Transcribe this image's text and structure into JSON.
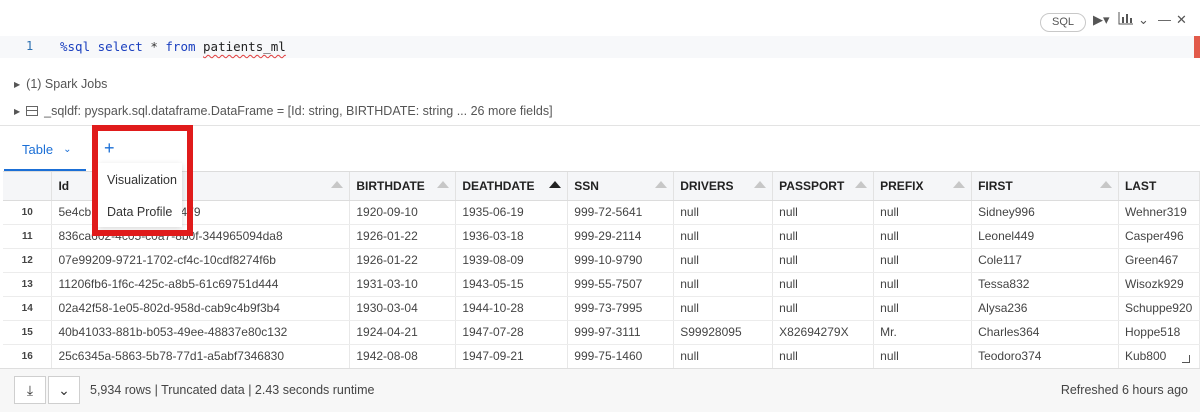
{
  "toolbar": {
    "language": "SQL",
    "run_icon": "play-icon",
    "chart_icon": "chart-icon",
    "collapse_icon": "chevron-down-icon",
    "minimize_icon": "minus-icon",
    "close_icon": "close-icon"
  },
  "editor": {
    "line_number": "1",
    "magic": "%sql",
    "keyword_select": "select",
    "star": "*",
    "keyword_from": "from",
    "table_name": "patients_ml"
  },
  "info": {
    "spark_jobs": "(1) Spark Jobs",
    "dataframe": "_sqldf:  pyspark.sql.dataframe.DataFrame = [Id: string, BIRTHDATE: string ... 26 more fields]"
  },
  "tabs": {
    "table_label": "Table",
    "add_label": "+"
  },
  "dropdown": {
    "visualization": "Visualization",
    "data_profile": "Data Profile"
  },
  "table": {
    "columns": [
      "Id",
      "BIRTHDATE",
      "DEATHDATE",
      "SSN",
      "DRIVERS",
      "PASSPORT",
      "PREFIX",
      "FIRST",
      "LAST"
    ],
    "sorted_column": "DEATHDATE",
    "rows": [
      {
        "n": "10",
        "cells": [
          "5e4cb... 38-5cbc5b988479",
          "1920-09-10",
          "1935-06-19",
          "999-72-5641",
          "null",
          "null",
          "null",
          "Sidney996",
          "Wehner319"
        ]
      },
      {
        "n": "11",
        "cells": [
          "836ca602-4c05-c0a7-8b0f-344965094da8",
          "1926-01-22",
          "1936-03-18",
          "999-29-2114",
          "null",
          "null",
          "null",
          "Leonel449",
          "Casper496"
        ]
      },
      {
        "n": "12",
        "cells": [
          "07e99209-9721-1702-cf4c-10cdf8274f6b",
          "1926-01-22",
          "1939-08-09",
          "999-10-9790",
          "null",
          "null",
          "null",
          "Cole117",
          "Green467"
        ]
      },
      {
        "n": "13",
        "cells": [
          "11206fb6-1f6c-425c-a8b5-61c69751d444",
          "1931-03-10",
          "1943-05-15",
          "999-55-7507",
          "null",
          "null",
          "null",
          "Tessa832",
          "Wisozk929"
        ]
      },
      {
        "n": "14",
        "cells": [
          "02a42f58-1e05-802d-958d-cab9c4b9f3b4",
          "1930-03-04",
          "1944-10-28",
          "999-73-7995",
          "null",
          "null",
          "null",
          "Alysa236",
          "Schuppe920"
        ]
      },
      {
        "n": "15",
        "cells": [
          "40b41033-881b-b053-49ee-48837e80c132",
          "1924-04-21",
          "1947-07-28",
          "999-97-3111",
          "S99928095",
          "X82694279X",
          "Mr.",
          "Charles364",
          "Hoppe518"
        ]
      },
      {
        "n": "16",
        "cells": [
          "25c6345a-5863-5b78-77d1-a5abf7346830",
          "1942-08-08",
          "1947-09-21",
          "999-75-1460",
          "null",
          "null",
          "null",
          "Teodoro374",
          "Kub800"
        ]
      }
    ]
  },
  "footer": {
    "download_icon": "download-icon",
    "expand_icon": "chevron-down-icon",
    "status": "5,934 rows  |  Truncated data  |  2.43 seconds runtime",
    "refreshed": "Refreshed 6 hours ago"
  },
  "colors": {
    "accent": "#1b6fd6",
    "highlight_box": "#e01b1b",
    "error_underline": "#e03c3c"
  }
}
